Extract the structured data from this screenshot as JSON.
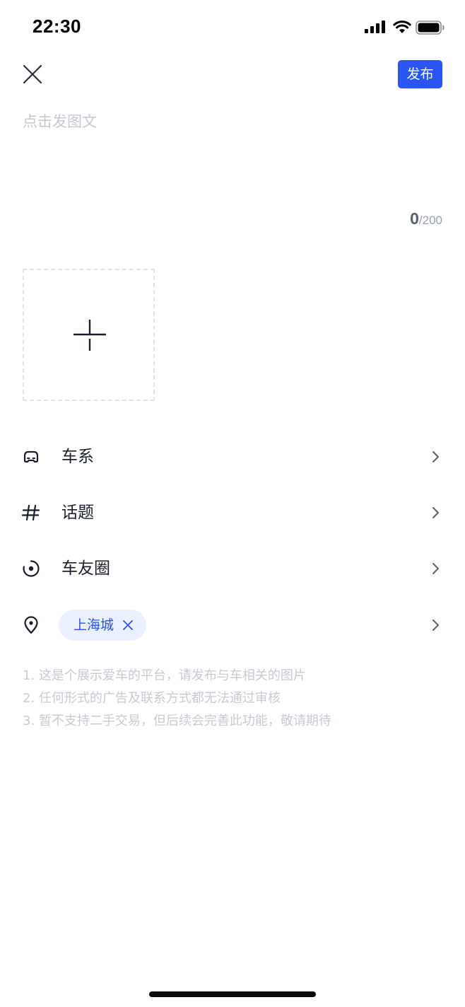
{
  "status_bar": {
    "time": "22:30"
  },
  "header": {
    "publish_label": "发布"
  },
  "editor": {
    "placeholder": "点击发图文",
    "count": "0",
    "max_count": "/200"
  },
  "options": [
    {
      "label": "车系",
      "icon": "car-icon"
    },
    {
      "label": "话题",
      "icon": "hashtag-icon"
    },
    {
      "label": "车友圈",
      "icon": "circle-icon"
    }
  ],
  "location": {
    "icon": "location-pin-icon",
    "value": "上海城"
  },
  "tips": [
    "1. 这是个展示爱车的平台，请发布与车相关的图片",
    "2. 任何形式的广告及联系方式都无法通过审核",
    "3. 暂不支持二手交易，但后续会完善此功能，敬请期待"
  ],
  "colors": {
    "accent": "#2a55f3",
    "chip_bg": "#eaf0ff",
    "placeholder": "#c4c8d2"
  }
}
